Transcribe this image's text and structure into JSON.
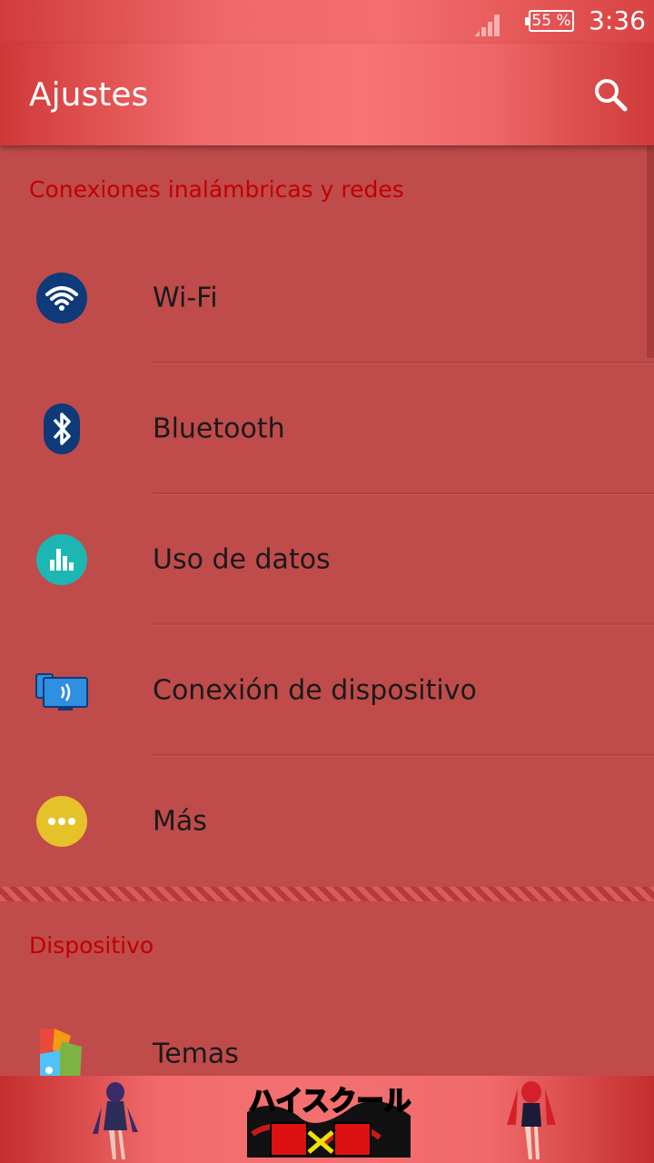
{
  "status_bar": {
    "battery": "55 %",
    "time": "3:36"
  },
  "app_bar": {
    "title": "Ajustes",
    "search_icon": "search-icon"
  },
  "sections": {
    "wireless": {
      "header": "Conexiones inalámbricas y redes",
      "items": [
        {
          "label": "Wi-Fi",
          "icon": "wifi-icon",
          "color": "#0e3a7a"
        },
        {
          "label": "Bluetooth",
          "icon": "bluetooth-icon",
          "color": "#0e3a7a"
        },
        {
          "label": "Uso de datos",
          "icon": "data-usage-icon",
          "color": "#1db6b2"
        },
        {
          "label": "Conexión de dispositivo",
          "icon": "device-connection-icon",
          "color": "#2f8fe0"
        },
        {
          "label": "Más",
          "icon": "more-icon",
          "color": "#e6c22a"
        }
      ]
    },
    "device": {
      "header": "Dispositivo",
      "items": [
        {
          "label": "Temas",
          "icon": "themes-icon"
        }
      ]
    }
  },
  "banner": {
    "logo": "ハイスクール DxD"
  },
  "colors": {
    "accent": "#c00000",
    "background": "#c04b4b",
    "appbar": "#f06a6a"
  }
}
